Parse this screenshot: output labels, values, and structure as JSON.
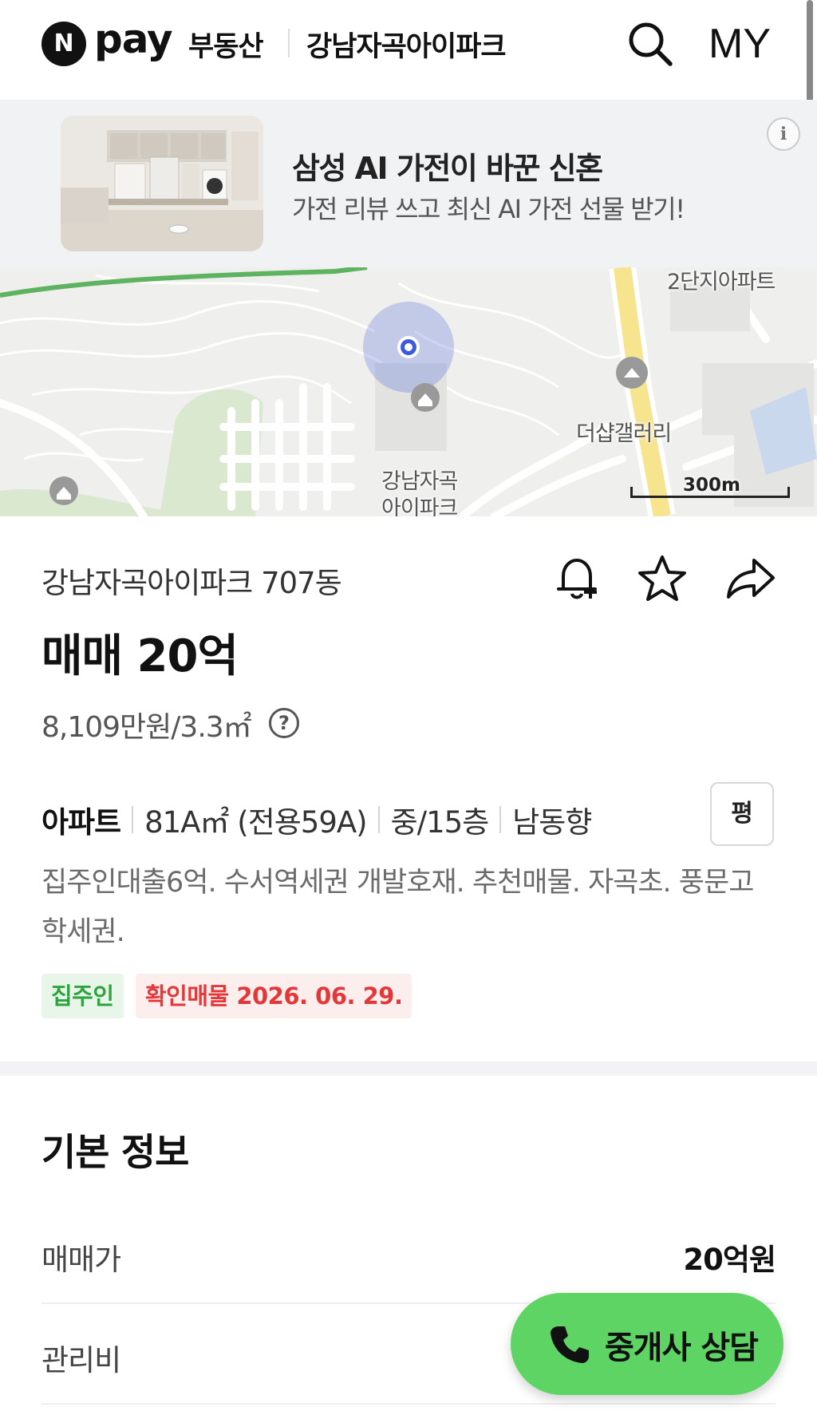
{
  "header": {
    "logo_letter": "N",
    "logo_pay": "pay",
    "service": "부동산",
    "complex": "강남자곡아이파크",
    "search_icon": "search-icon",
    "my_label": "MY"
  },
  "ad": {
    "title": "삼성 AI 가전이 바꾼 신혼",
    "subtitle": "가전 리뷰 쓰고 최신 AI 가전 선물 받기!",
    "info_label": "i"
  },
  "map": {
    "labels": {
      "apt_2": "2단지아파트",
      "gallery": "더샵갤러리",
      "complex_line1": "강남자곡",
      "complex_line2": "아이파크"
    },
    "scale": "300m"
  },
  "listing": {
    "name": "강남자곡아이파크 707동",
    "price_title": "매매 20억",
    "unit_price": "8,109만원/3.3㎡",
    "help_label": "?",
    "type": "아파트",
    "area": "81A㎡ (전용59A)",
    "floor": "중/15층",
    "direction": "남동향",
    "pyeong_button": "평",
    "description": "집주인대출6억. 수서역세권 개발호재. 추천매물. 자곡초. 풍문고 학세권.",
    "badge_owner": "집주인",
    "badge_verified": "확인매물 2026. 06. 29."
  },
  "basic_info": {
    "title": "기본 정보",
    "rows": [
      {
        "label": "매매가",
        "value": "20억원"
      },
      {
        "label": "관리비",
        "value": ""
      }
    ]
  },
  "fab": {
    "label": "중개사 상담",
    "icon": "phone-icon",
    "color": "#5ed464"
  },
  "colors": {
    "accent_green": "#2fa33f",
    "accent_red": "#e3383a",
    "location_blue": "#3b5bdb"
  }
}
